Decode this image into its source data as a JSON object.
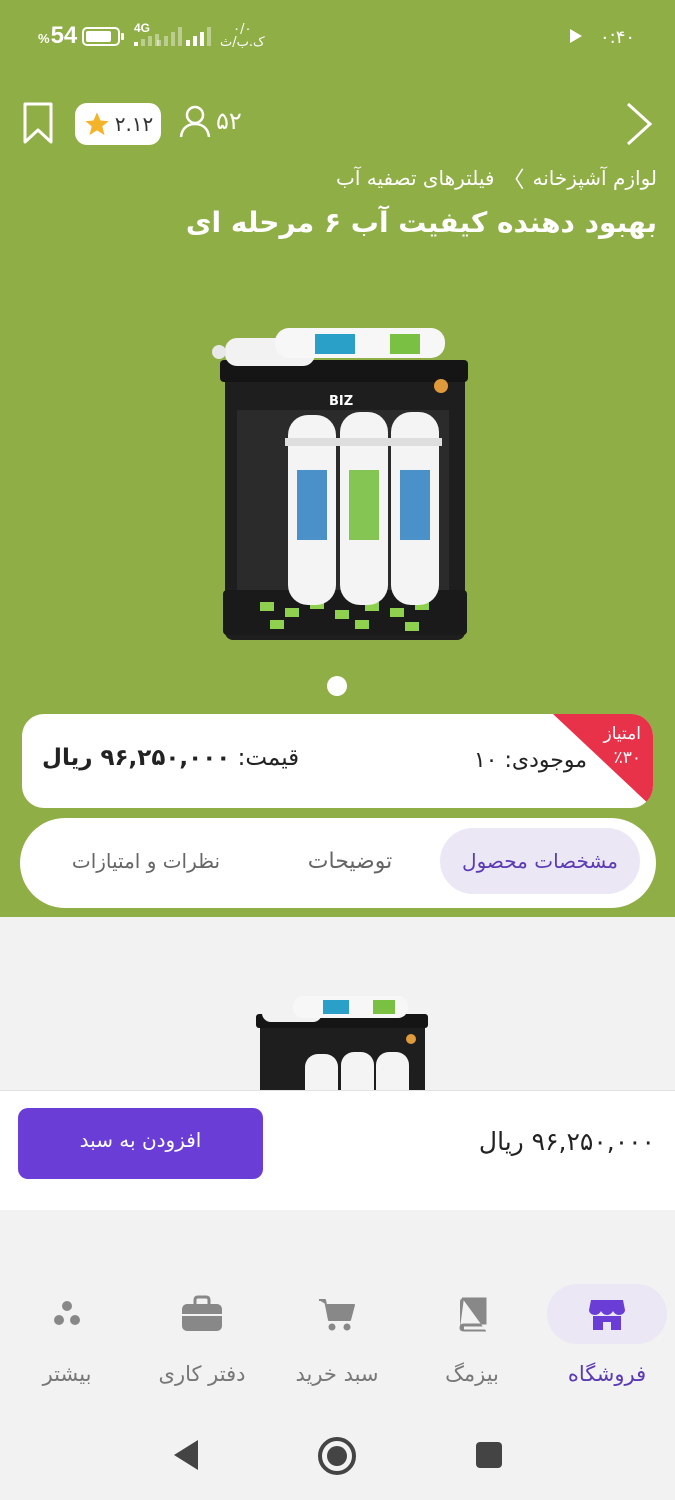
{
  "status_bar": {
    "battery_percent": "54",
    "percent_sign": "%",
    "network_type": "4G",
    "data_speed_value": "۰/۰",
    "data_speed_unit": "ک.ب/ث",
    "time": "۰:۴۰"
  },
  "header": {
    "rating": "۲.۱۲",
    "followers": "۵۲"
  },
  "breadcrumb": {
    "category": "لوازم آشپزخانه",
    "separator": "〉",
    "subcategory": "فیلترهای تصفیه آب"
  },
  "product": {
    "title": "بهبود دهنده کیفیت آب ۶ مرحله ای",
    "image_brand_text": "BIZ",
    "ribbon_line1": "امتیاز",
    "ribbon_line2": "٪۳۰",
    "stock_label": "موجودی:",
    "stock_value": "۱۰",
    "price_label": "قیمت:",
    "price_value": "۹۶,۲۵۰,۰۰۰ ریال"
  },
  "tabs": [
    {
      "label": "مشخصات محصول",
      "active": true
    },
    {
      "label": "توضیحات",
      "active": false
    },
    {
      "label": "نظرات و امتیازات",
      "active": false
    }
  ],
  "buy_bar": {
    "price": "۹۶,۲۵۰,۰۰۰ ریال",
    "add_to_cart": "افزودن به سبد"
  },
  "bottom_nav": [
    {
      "label": "فروشگاه",
      "icon": "store-icon",
      "active": true
    },
    {
      "label": "بیزمگ",
      "icon": "book-icon",
      "active": false
    },
    {
      "label": "سبد خرید",
      "icon": "cart-icon",
      "active": false
    },
    {
      "label": "دفتر کاری",
      "icon": "briefcase-icon",
      "active": false
    },
    {
      "label": "بیشتر",
      "icon": "more-icon",
      "active": false
    }
  ],
  "colors": {
    "header_green": "#8fae45",
    "primary_purple": "#6a3ed6",
    "ribbon_red": "#e8324a",
    "active_tab_bg": "#ece7f5"
  }
}
